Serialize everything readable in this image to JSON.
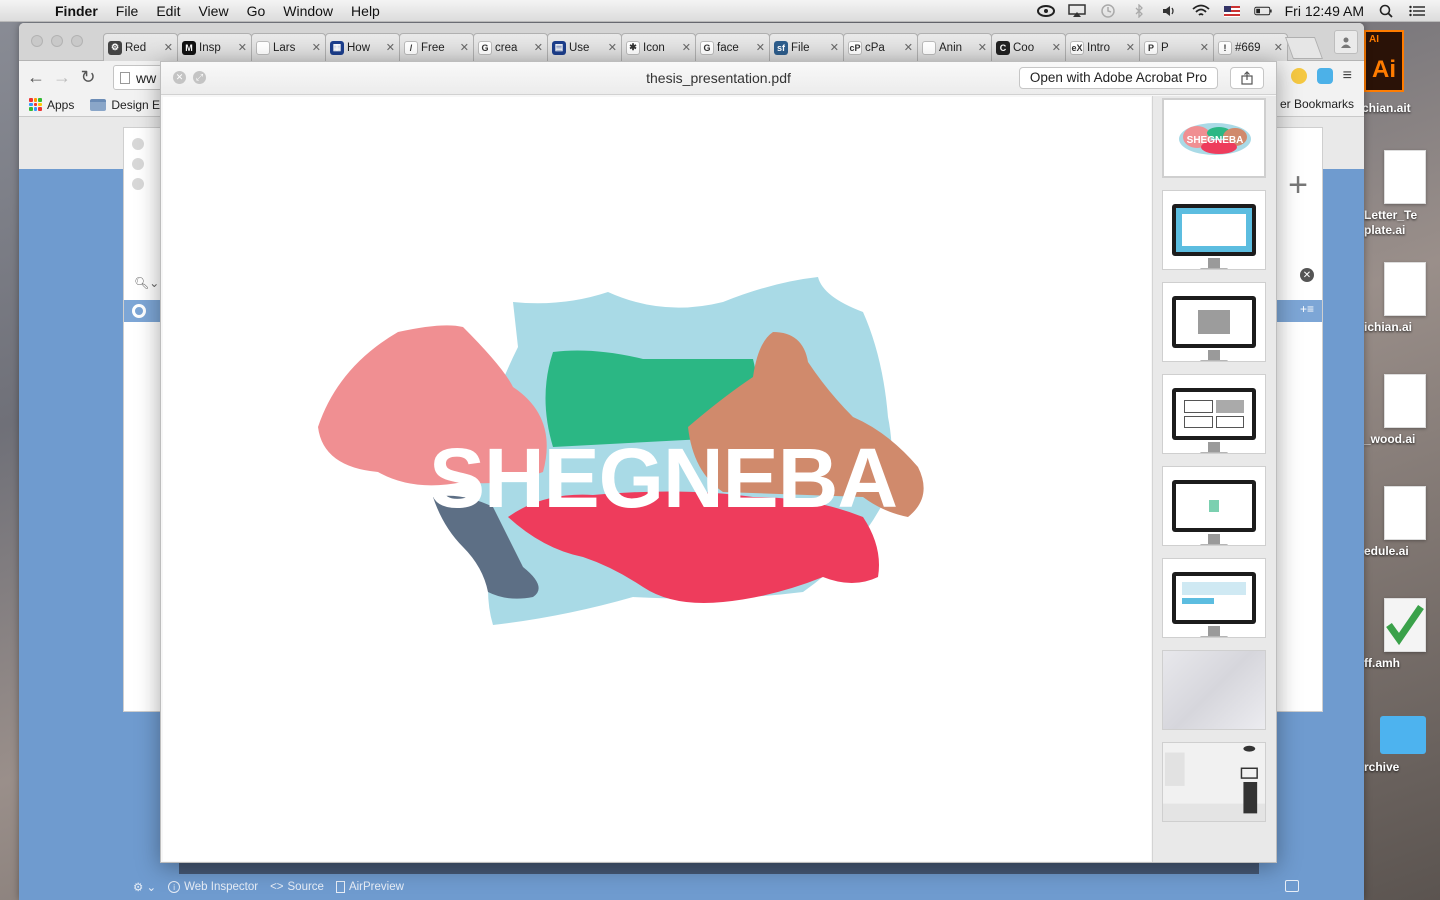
{
  "menubar": {
    "app": "Finder",
    "items": [
      "File",
      "Edit",
      "View",
      "Go",
      "Window",
      "Help"
    ],
    "clock": "Fri 12:49 AM"
  },
  "browser": {
    "tabs": [
      {
        "label": "Red",
        "icon": "gear-favicon",
        "color": "#444444",
        "glyph": "⚙"
      },
      {
        "label": "Insp",
        "icon": "medium-favicon",
        "color": "#111111",
        "glyph": "M"
      },
      {
        "label": "Lars",
        "icon": "page-favicon",
        "color": "#ffffff",
        "glyph": ""
      },
      {
        "label": "How",
        "icon": "site-favicon",
        "color": "#1c3e8c",
        "glyph": "▦"
      },
      {
        "label": "Free",
        "icon": "feather-favicon",
        "color": "#ffffff",
        "glyph": "/"
      },
      {
        "label": "crea",
        "icon": "google-favicon",
        "color": "#ffffff",
        "glyph": "G"
      },
      {
        "label": "Use",
        "icon": "doc-favicon",
        "color": "#1c3e8c",
        "glyph": "▤"
      },
      {
        "label": "Icon",
        "icon": "asterisk-favicon",
        "color": "#ffffff",
        "glyph": "✱"
      },
      {
        "label": "face",
        "icon": "google-favicon",
        "color": "#ffffff",
        "glyph": "G"
      },
      {
        "label": "File",
        "icon": "sf-favicon",
        "color": "#2d5d8c",
        "glyph": "sf"
      },
      {
        "label": "cPa",
        "icon": "cpanel-favicon",
        "color": "#ffffff",
        "glyph": "cP"
      },
      {
        "label": "Anin",
        "icon": "page-favicon",
        "color": "#ffffff",
        "glyph": ""
      },
      {
        "label": "Coo",
        "icon": "c-favicon",
        "color": "#222222",
        "glyph": "C"
      },
      {
        "label": "Intro",
        "icon": "edx-favicon",
        "color": "#ffffff",
        "glyph": "eX"
      },
      {
        "label": "P",
        "icon": "p-favicon",
        "color": "#ffffff",
        "glyph": "P"
      },
      {
        "label": "#669",
        "icon": "github-favicon",
        "color": "#ffffff",
        "glyph": "!"
      }
    ],
    "url_fragment": "ww",
    "bookmarks": {
      "apps_label": "Apps",
      "folder_label": "Design E",
      "other_label": "er Bookmarks"
    },
    "devtools": {
      "inspector": "Web Inspector",
      "source": "Source",
      "airpreview": "AirPreview"
    }
  },
  "pdf_viewer": {
    "filename": "thesis_presentation.pdf",
    "open_with_label": "Open with Adobe Acrobat Pro",
    "page_title_art": "SHEGNEBA",
    "thumbnail_count": 8,
    "active_thumbnail": 1,
    "thumb_logo_text": "SHEGNEBA"
  },
  "desktop": {
    "ai_label": "chian.ait",
    "icons": [
      {
        "label": "Letter_Te\nplate.ai"
      },
      {
        "label": "ichian.ai"
      },
      {
        "label": "_wood.ai"
      },
      {
        "label": "edule.ai"
      },
      {
        "label": "ff.amh"
      },
      {
        "label": "rchive"
      }
    ]
  },
  "colors": {
    "logo_coral": "#f08f92",
    "logo_green": "#2bb784",
    "logo_lightblue": "#a9dae6",
    "logo_tan": "#d08a6c",
    "logo_red": "#ee3c5c",
    "logo_slate": "#5d6f85",
    "page_blue": "#6f9bcf"
  }
}
